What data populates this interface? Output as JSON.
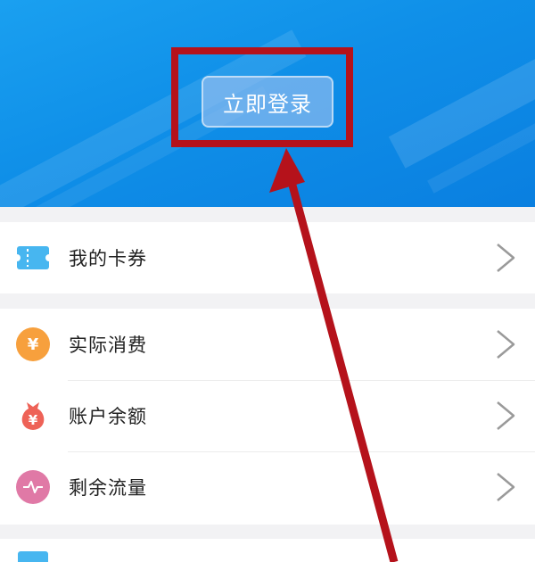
{
  "header": {
    "login_label": "立即登录"
  },
  "menu": {
    "group1": [
      {
        "label": "我的卡券",
        "icon": "ticket-icon"
      }
    ],
    "group2": [
      {
        "label": "实际消费",
        "icon": "yen-coin-icon"
      },
      {
        "label": "账户余额",
        "icon": "money-bag-icon"
      },
      {
        "label": "剩余流量",
        "icon": "data-wave-icon"
      }
    ]
  },
  "colors": {
    "header_blue": "#0f8fe8",
    "highlight_red": "#b5121b",
    "coin_orange": "#f7a03d",
    "bag_red": "#ee6257",
    "wave_pink": "#e079a6",
    "ticket_blue": "#47b6f0"
  }
}
